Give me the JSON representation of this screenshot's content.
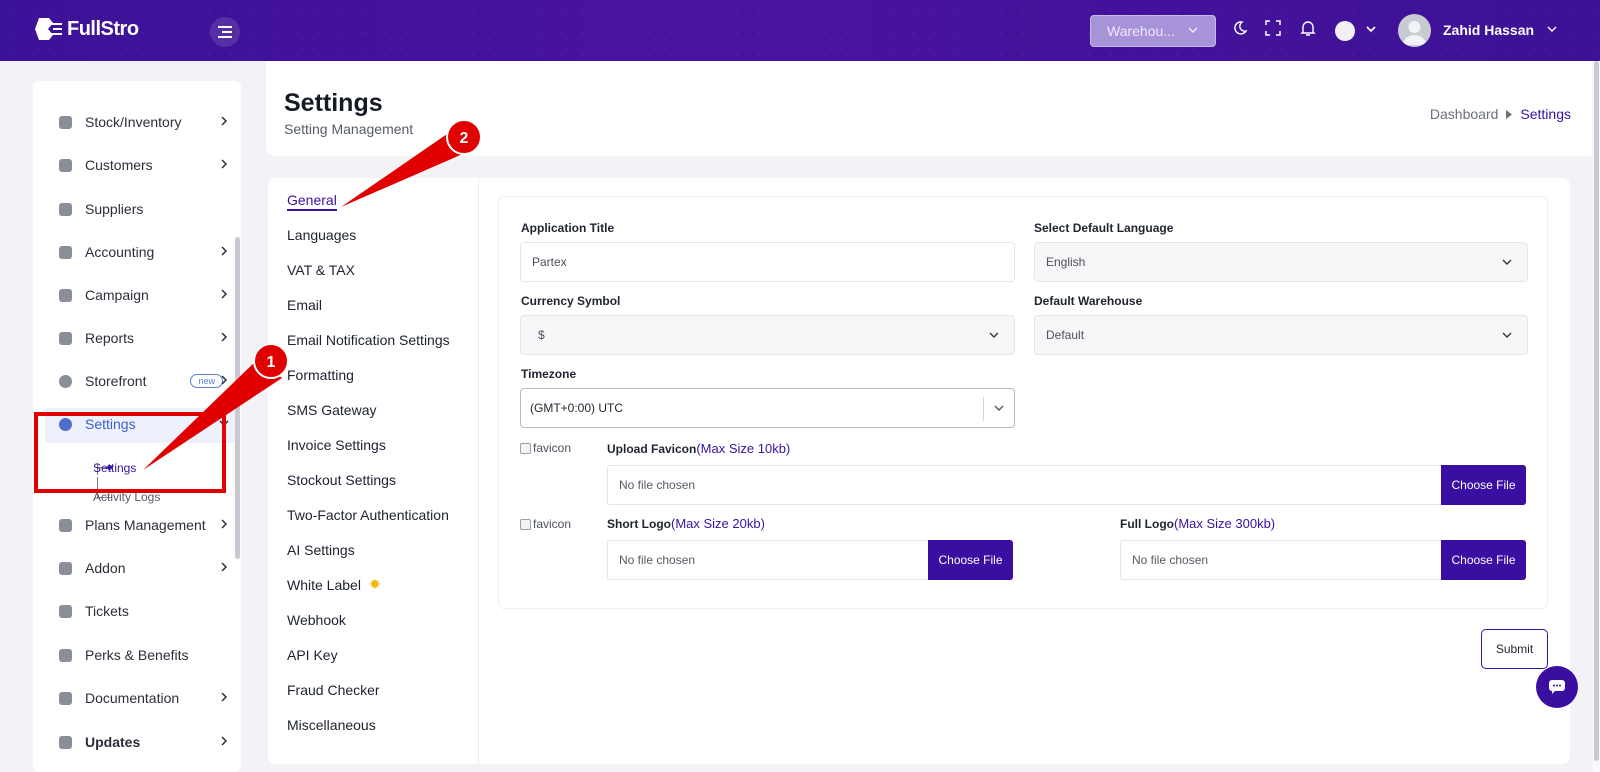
{
  "brand": {
    "name": "FullStro"
  },
  "topbar": {
    "warehouse_select": "Warehou...",
    "user_name": "Zahid Hassan",
    "icons": [
      "menu-icon",
      "moon-icon",
      "fullscreen-icon",
      "bell-icon",
      "flag-icon",
      "avatar-icon",
      "chevron-down-icon"
    ]
  },
  "sidebar": {
    "items": [
      {
        "label": "Stock/Inventory",
        "icon": "box-icon",
        "arrow": true
      },
      {
        "label": "Customers",
        "icon": "users-icon",
        "arrow": true
      },
      {
        "label": "Suppliers",
        "icon": "supplier-icon",
        "arrow": false
      },
      {
        "label": "Accounting",
        "icon": "accounting-icon",
        "arrow": true
      },
      {
        "label": "Campaign",
        "icon": "campaign-icon",
        "arrow": true
      },
      {
        "label": "Reports",
        "icon": "report-icon",
        "arrow": true
      },
      {
        "label": "Storefront",
        "icon": "storefront-icon",
        "arrow": true,
        "badge": "new"
      },
      {
        "label": "Settings",
        "icon": "settings-icon",
        "arrow": true,
        "active": true
      },
      {
        "label": "Plans Management",
        "icon": "plans-icon",
        "arrow": true
      },
      {
        "label": "Addon",
        "icon": "addon-icon",
        "arrow": true
      },
      {
        "label": "Tickets",
        "icon": "ticket-icon",
        "arrow": false
      },
      {
        "label": "Perks & Benefits",
        "icon": "perks-icon",
        "arrow": false
      },
      {
        "label": "Documentation",
        "icon": "doc-icon",
        "arrow": true
      },
      {
        "label": "Updates",
        "icon": "updates-icon",
        "arrow": true
      }
    ],
    "settings_children": [
      {
        "label": "Settings",
        "active": true
      },
      {
        "label": "Activity Logs",
        "active": false
      }
    ]
  },
  "header": {
    "title": "Settings",
    "subtitle": "Setting Management",
    "breadcrumb": [
      "Dashboard",
      "Settings"
    ]
  },
  "settings_nav": [
    "General",
    "Languages",
    "VAT & TAX",
    "Email",
    "Email Notification Settings",
    "Formatting",
    "SMS Gateway",
    "Invoice Settings",
    "Stockout Settings",
    "Two-Factor Authentication",
    "AI Settings",
    "White Label",
    "Webhook",
    "API Key",
    "Fraud Checker",
    "Miscellaneous"
  ],
  "form": {
    "application_title": {
      "label": "Application Title",
      "value": "Partex"
    },
    "default_language": {
      "label": "Select Default Language",
      "value": "English"
    },
    "currency_symbol": {
      "label": "Currency Symbol",
      "value": "$"
    },
    "default_warehouse": {
      "label": "Default Warehouse",
      "value": "Default"
    },
    "timezone": {
      "label": "Timezone",
      "value": "(GMT+0:00) UTC"
    },
    "favicon_alt": "favicon",
    "upload_favicon": {
      "label": "Upload Favicon",
      "hint": "(Max Size 10kb)",
      "file": "No file chosen",
      "button": "Choose File"
    },
    "short_logo": {
      "label": "Short Logo",
      "hint": "(Max Size 20kb)",
      "file": "No file chosen",
      "button": "Choose File"
    },
    "full_logo": {
      "label": "Full Logo",
      "hint": "(Max Size 300kb)",
      "file": "No file chosen",
      "button": "Choose File"
    },
    "submit": "Submit"
  },
  "annotations": {
    "step1": "1",
    "step2": "2"
  },
  "colors": {
    "brand": "#3a12a0",
    "topbar": "#4a139e",
    "annotation": "#e10000"
  }
}
